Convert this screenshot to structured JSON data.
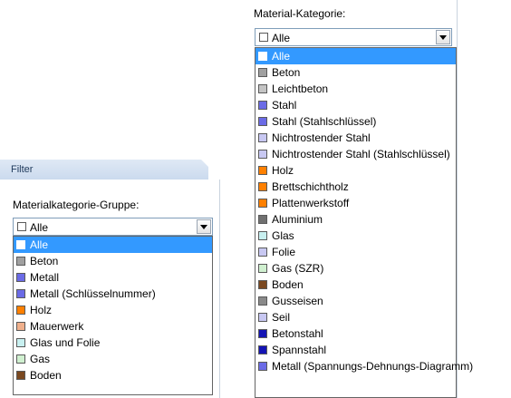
{
  "left": {
    "header_title": "Filter",
    "group_label": "Materialkategorie-Gruppe:",
    "combo_value": "Alle",
    "items": [
      {
        "label": "Alle",
        "color": "#ffffff",
        "selected": true
      },
      {
        "label": "Beton",
        "color": "#a0a0a0"
      },
      {
        "label": "Metall",
        "color": "#6b6be6"
      },
      {
        "label": "Metall (Schlüsselnummer)",
        "color": "#6b6be6"
      },
      {
        "label": "Holz",
        "color": "#ff8000"
      },
      {
        "label": "Mauerwerk",
        "color": "#f0b08c"
      },
      {
        "label": "Glas und Folie",
        "color": "#c8f0f0"
      },
      {
        "label": "Gas",
        "color": "#d0f0d0"
      },
      {
        "label": "Boden",
        "color": "#7a4820"
      }
    ]
  },
  "right": {
    "category_label": "Material-Kategorie:",
    "combo_value": "Alle",
    "items": [
      {
        "label": "Alle",
        "color": "#ffffff",
        "selected": true
      },
      {
        "label": "Beton",
        "color": "#a0a0a0"
      },
      {
        "label": "Leichtbeton",
        "color": "#c4c4c4"
      },
      {
        "label": "Stahl",
        "color": "#6b6be6"
      },
      {
        "label": "Stahl (Stahlschlüssel)",
        "color": "#6b6be6"
      },
      {
        "label": "Nichtrostender Stahl",
        "color": "#c8c8f2"
      },
      {
        "label": "Nichtrostender Stahl (Stahlschlüssel)",
        "color": "#c8c8f2"
      },
      {
        "label": "Holz",
        "color": "#ff8000"
      },
      {
        "label": "Brettschichtholz",
        "color": "#ff8000"
      },
      {
        "label": "Plattenwerkstoff",
        "color": "#ff8000"
      },
      {
        "label": "Aluminium",
        "color": "#707070"
      },
      {
        "label": "Glas",
        "color": "#c8f0f0"
      },
      {
        "label": "Folie",
        "color": "#c8c8f2"
      },
      {
        "label": "Gas (SZR)",
        "color": "#d0f0d0"
      },
      {
        "label": "Boden",
        "color": "#7a4820"
      },
      {
        "label": "Gusseisen",
        "color": "#8a8a8a"
      },
      {
        "label": "Seil",
        "color": "#c8c8f2"
      },
      {
        "label": "Betonstahl",
        "color": "#1414b4"
      },
      {
        "label": "Spannstahl",
        "color": "#1414b4"
      },
      {
        "label": "Metall (Spannungs-Dehnungs-Diagramm)",
        "color": "#6b6be6"
      }
    ]
  }
}
